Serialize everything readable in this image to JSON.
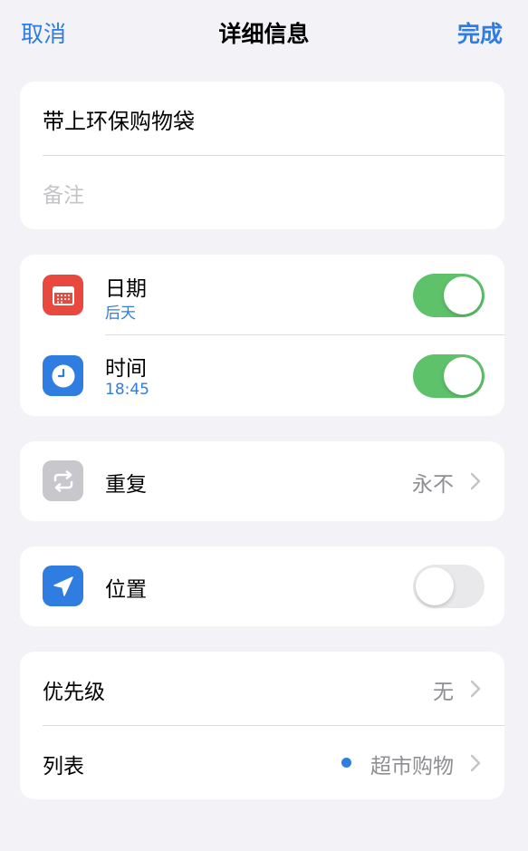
{
  "nav": {
    "cancel": "取消",
    "title": "详细信息",
    "done": "完成"
  },
  "reminder": {
    "title": "带上环保购物袋",
    "notes_placeholder": "备注"
  },
  "date": {
    "label": "日期",
    "value": "后天",
    "enabled": true,
    "icon": "calendar-icon",
    "icon_color": "#e9483f"
  },
  "time": {
    "label": "时间",
    "value": "18:45",
    "enabled": true,
    "icon": "clock-icon",
    "icon_color": "#2f7de1"
  },
  "repeat": {
    "label": "重复",
    "value": "永不",
    "icon": "repeat-icon",
    "icon_color": "#c7c7cc"
  },
  "location": {
    "label": "位置",
    "enabled": false,
    "icon": "location-arrow-icon",
    "icon_color": "#2f7de1"
  },
  "priority": {
    "label": "优先级",
    "value": "无"
  },
  "list": {
    "label": "列表",
    "value": "超市购物",
    "color": "#2f7de1"
  },
  "colors": {
    "accent": "#2f7de1",
    "toggle_on": "#5ec26a"
  }
}
